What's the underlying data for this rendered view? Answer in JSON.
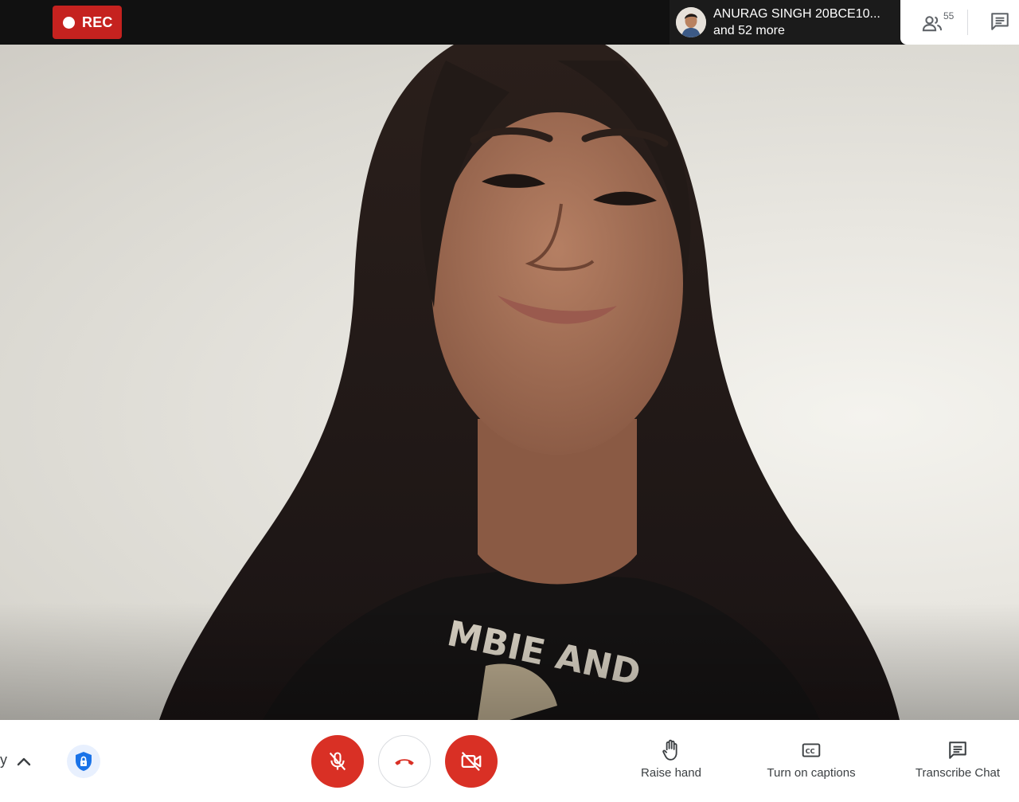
{
  "topbar": {
    "rec_label": "REC",
    "presenter": {
      "name": "ANURAG SINGH 20BCE10...",
      "others": "and 52 more"
    },
    "people_count": "55",
    "icons": {
      "people": "people-icon",
      "chat": "chat-icon"
    }
  },
  "bottombar": {
    "details_fragment": "y",
    "actions": {
      "raise_hand": "Raise hand",
      "captions": "Turn on captions",
      "transcribe": "Transcribe Chat"
    },
    "icons": {
      "chevron": "chevron-up-icon",
      "security": "shield-lock-icon",
      "mic": "mic-off-icon",
      "hangup": "phone-hangup-icon",
      "camera": "camera-off-icon",
      "hand": "hand-icon",
      "captions": "closed-captions-icon",
      "transcribe": "chat-icon"
    }
  },
  "colors": {
    "rec": "#c5221f",
    "danger": "#d93025",
    "topbar": "#111111",
    "shield": "#1a73e8"
  }
}
